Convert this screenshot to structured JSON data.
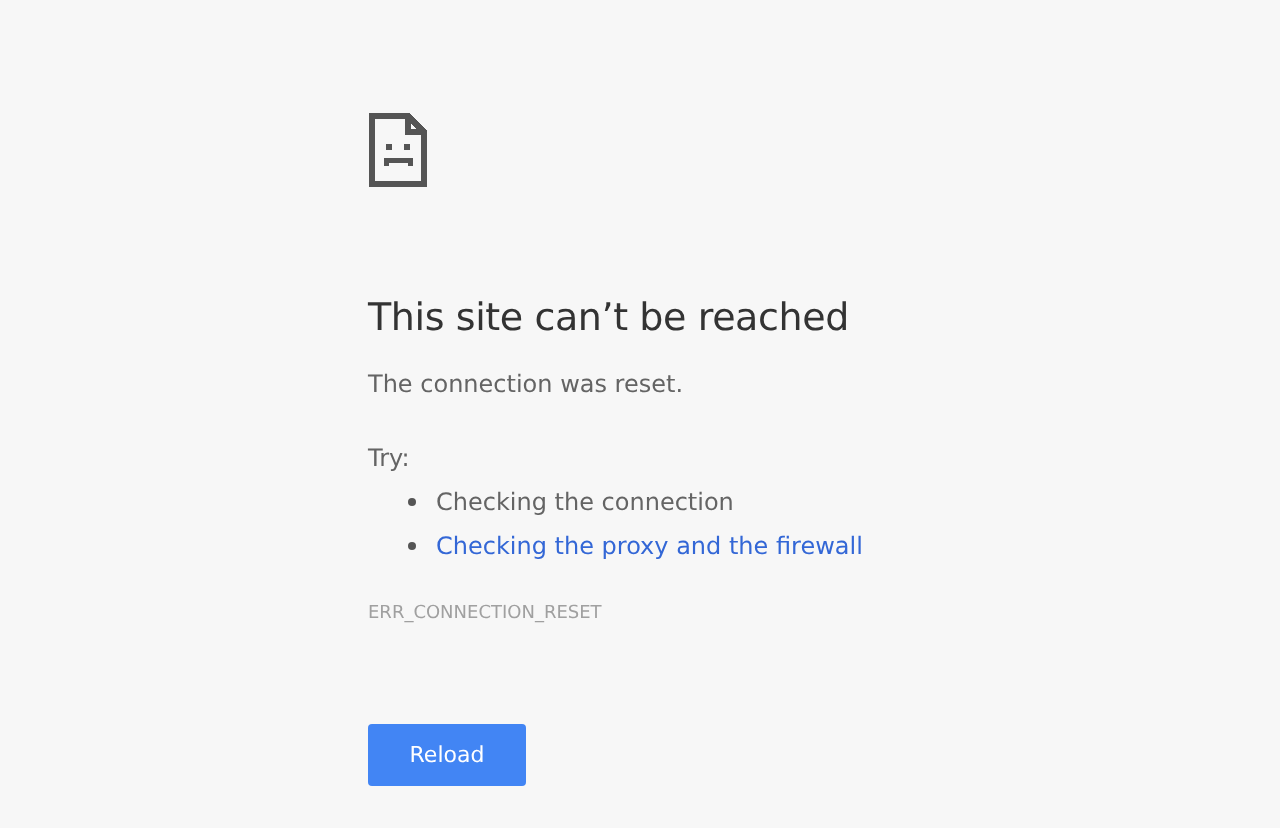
{
  "error_page": {
    "title": "This site can’t be reached",
    "message": "The connection was reset.",
    "try_label": "Try:",
    "suggestions": [
      {
        "kind": "text",
        "text": "Checking the connection"
      },
      {
        "kind": "link",
        "text": "Checking the proxy and the firewall"
      }
    ],
    "error_code": "ERR_CONNECTION_RESET",
    "button": "Reload"
  }
}
